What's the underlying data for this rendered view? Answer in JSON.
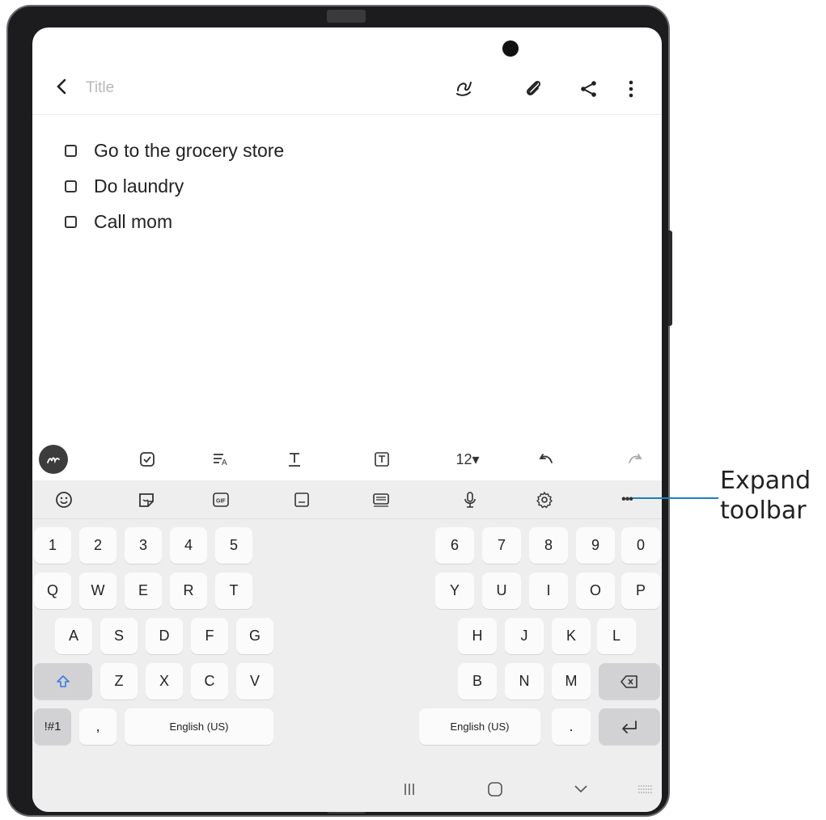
{
  "note": {
    "title_placeholder": "Title",
    "items": [
      {
        "text": "Go to the grocery store",
        "checked": false
      },
      {
        "text": "Do laundry",
        "checked": false
      },
      {
        "text": "Call mom",
        "checked": false
      }
    ]
  },
  "appbar": {
    "icons": [
      "back-icon",
      "handwriting-icon",
      "attach-icon",
      "share-icon",
      "more-options-icon"
    ]
  },
  "format_toolbar": {
    "font_size": "12▾",
    "icons": [
      "pen-mode-icon",
      "checkbox-icon",
      "paragraph-style-icon",
      "text-style-icon",
      "textbox-icon",
      "undo-icon",
      "redo-icon"
    ]
  },
  "keyboard_toolbar": {
    "icons": [
      "emoji-icon",
      "sticker-icon",
      "gif-icon",
      "clipboard-icon",
      "keyboard-mode-icon",
      "microphone-icon",
      "settings-icon",
      "expand-toolbar-icon"
    ],
    "expand_label": "•••"
  },
  "keyboard": {
    "left_rows": [
      [
        "1",
        "2",
        "3",
        "4",
        "5"
      ],
      [
        "Q",
        "W",
        "E",
        "R",
        "T"
      ],
      [
        "A",
        "S",
        "D",
        "F",
        "G"
      ],
      [
        "Z",
        "X",
        "C",
        "V"
      ]
    ],
    "right_rows": [
      [
        "6",
        "7",
        "8",
        "9",
        "0"
      ],
      [
        "Y",
        "U",
        "I",
        "O",
        "P"
      ],
      [
        "H",
        "J",
        "K",
        "L"
      ],
      [
        "B",
        "N",
        "M"
      ]
    ],
    "symbols_key": "!#1",
    "comma_key": ",",
    "period_key": ".",
    "space_left": "English (US)",
    "space_right": "English (US)"
  },
  "callout": {
    "line1": "Expand",
    "line2": "toolbar",
    "color": "#1f7fc1"
  }
}
